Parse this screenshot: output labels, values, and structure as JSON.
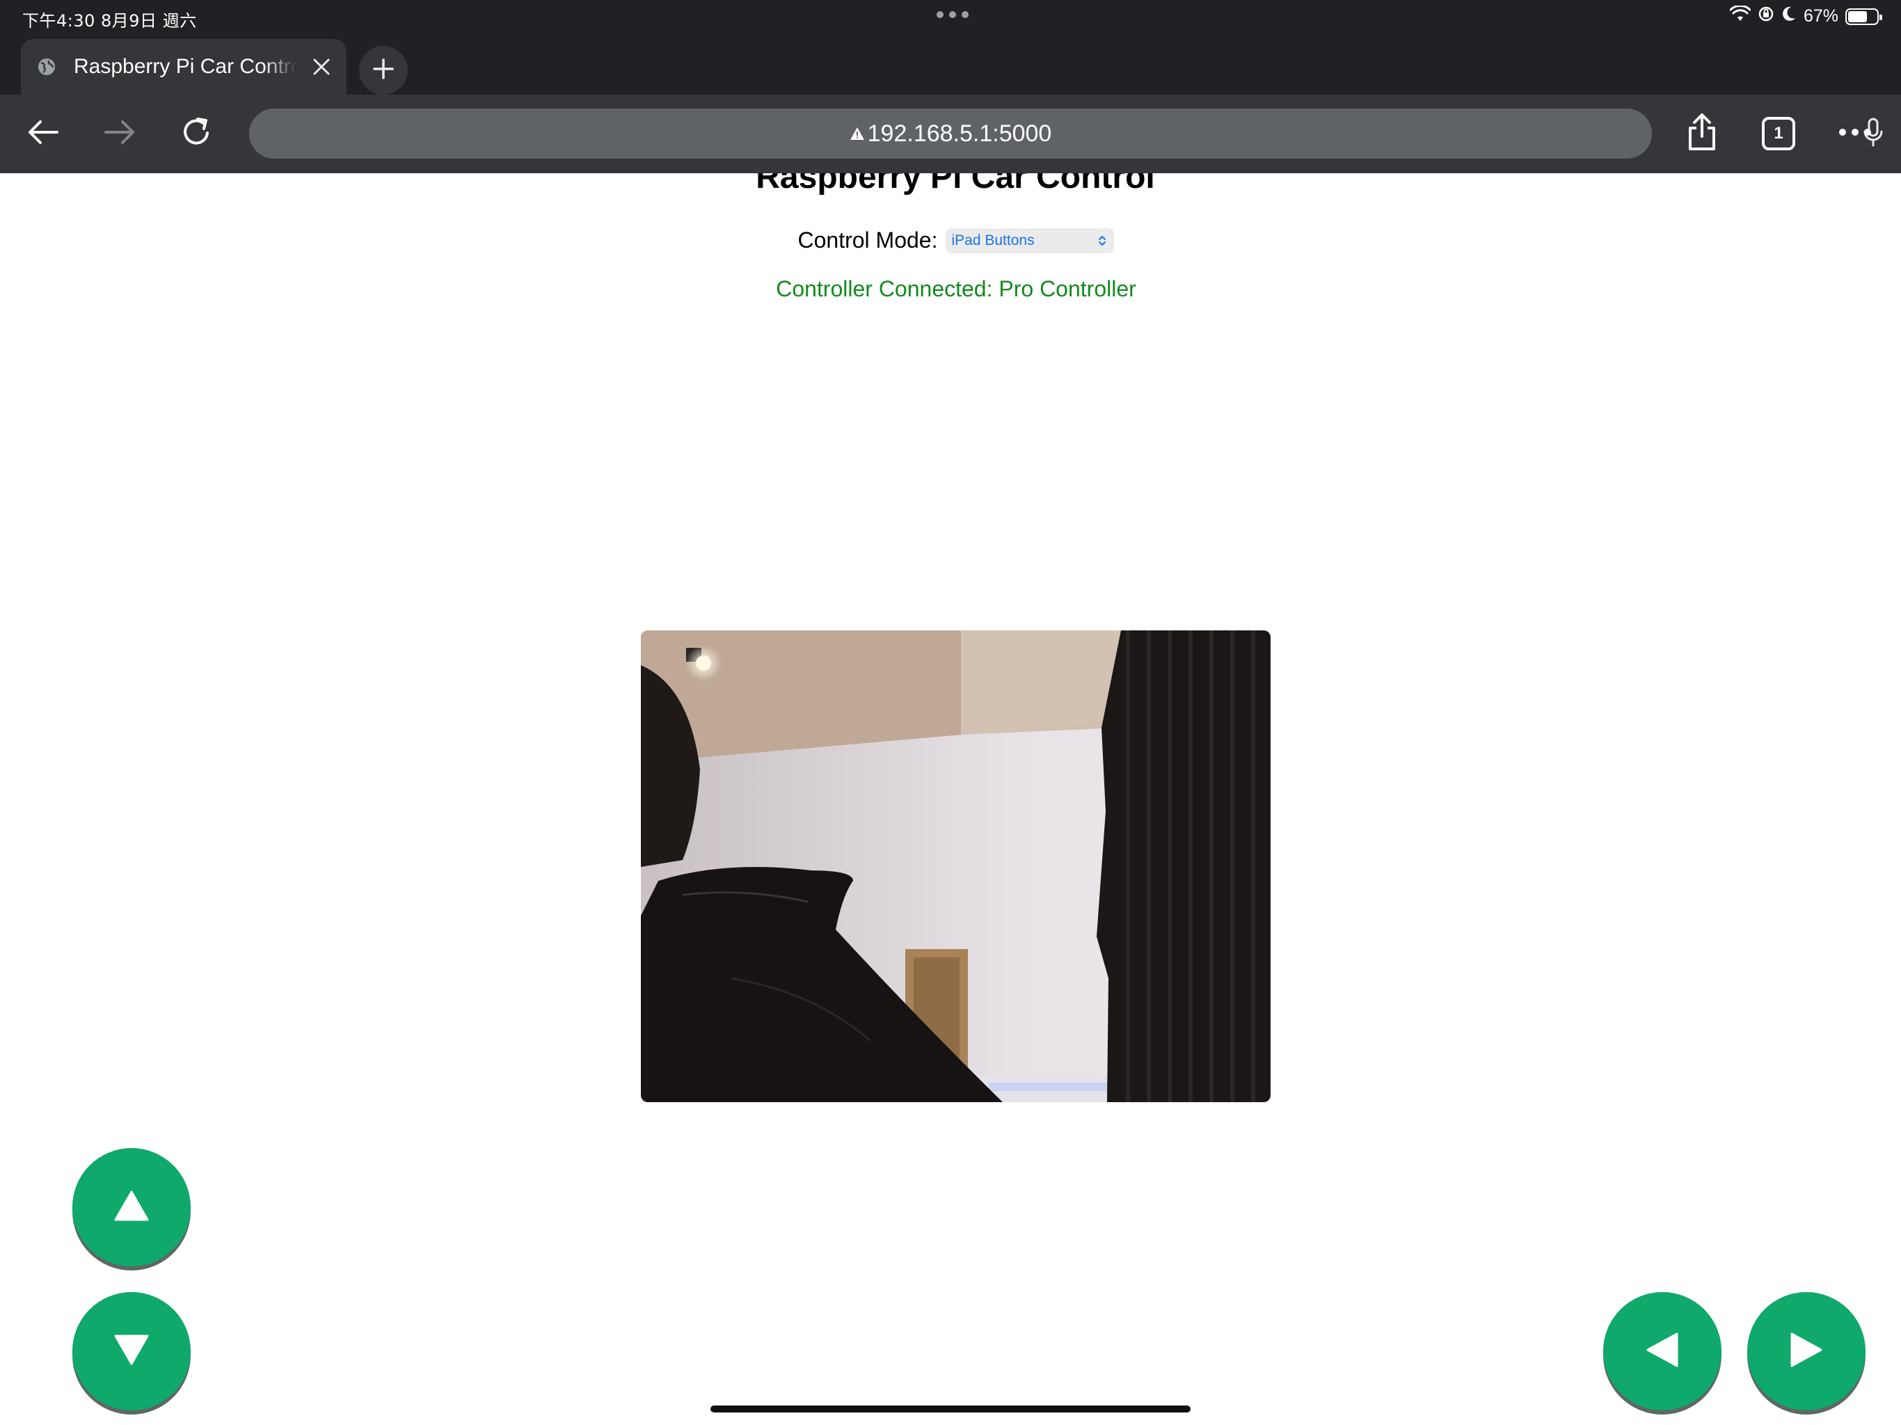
{
  "status_bar": {
    "time_date": "下午4:30  8月9日 週六",
    "battery_percent": "67%",
    "battery_level": 0.67
  },
  "browser": {
    "tab_title": "Raspberry Pi Car Control",
    "url": "192.168.5.1:5000",
    "tab_count": "1"
  },
  "page": {
    "title": "Raspberry Pi Car Control",
    "control_mode_label": "Control Mode:",
    "control_mode_value": "iPad Buttons",
    "controller_status": "Controller Connected: Pro Controller"
  },
  "colors": {
    "button_green": "#0fa96c",
    "status_green": "#138a1e",
    "select_text_blue": "#1a73e8"
  },
  "icons": {
    "forward": "up-arrow-icon",
    "backward": "down-arrow-icon",
    "left": "left-arrow-icon",
    "right": "right-arrow-icon"
  }
}
